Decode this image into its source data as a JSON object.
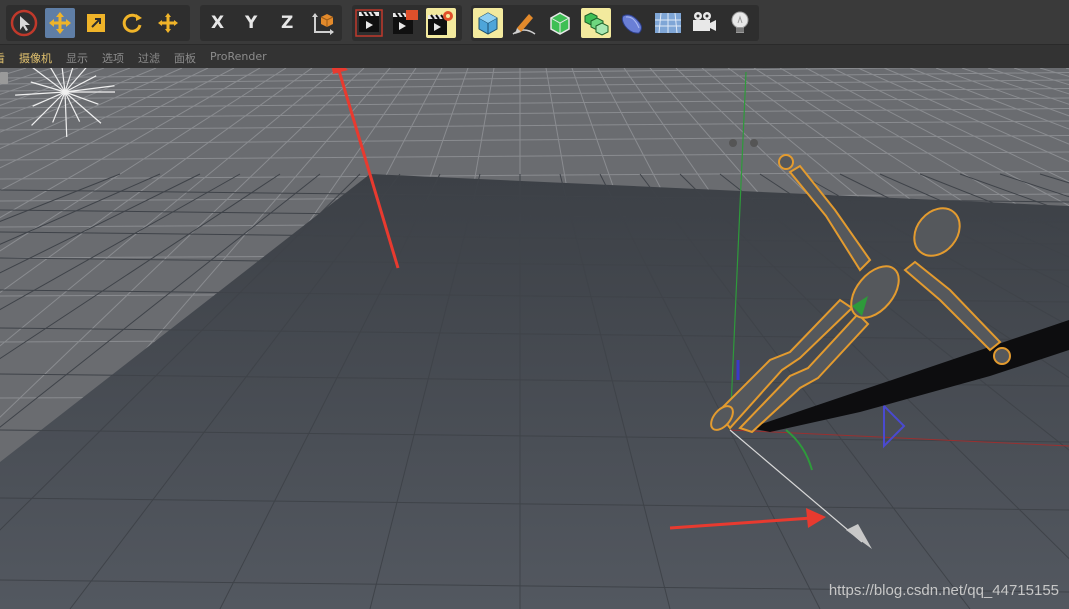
{
  "toolbar": {
    "axis_x": "X",
    "axis_y": "Y",
    "axis_z": "Z",
    "tools": [
      "select-tool",
      "move-tool",
      "scale-tool",
      "rotate-tool",
      "recent-tool",
      "x-axis-lock",
      "y-axis-lock",
      "z-axis-lock",
      "coordinate-system",
      "render-view",
      "render-to-picture-viewer",
      "render-settings",
      "cube-primitive",
      "pen-spline",
      "subdivision-surface",
      "array-generator",
      "deformer",
      "floor-environment",
      "camera",
      "light"
    ]
  },
  "menu": {
    "items": [
      "看",
      "摄像机",
      "显示",
      "选项",
      "过滤",
      "面板",
      "ProRender"
    ],
    "active": "摄像机"
  },
  "viewport": {
    "object": "figure",
    "colors": {
      "accent": "#e39b2f",
      "annotation": "#e83a2f",
      "x_axis": "#c0392b",
      "y_axis": "#2e9a3b",
      "z_axis": "#3a3ac8"
    }
  },
  "watermark": "https://blog.csdn.net/qq_44715155"
}
